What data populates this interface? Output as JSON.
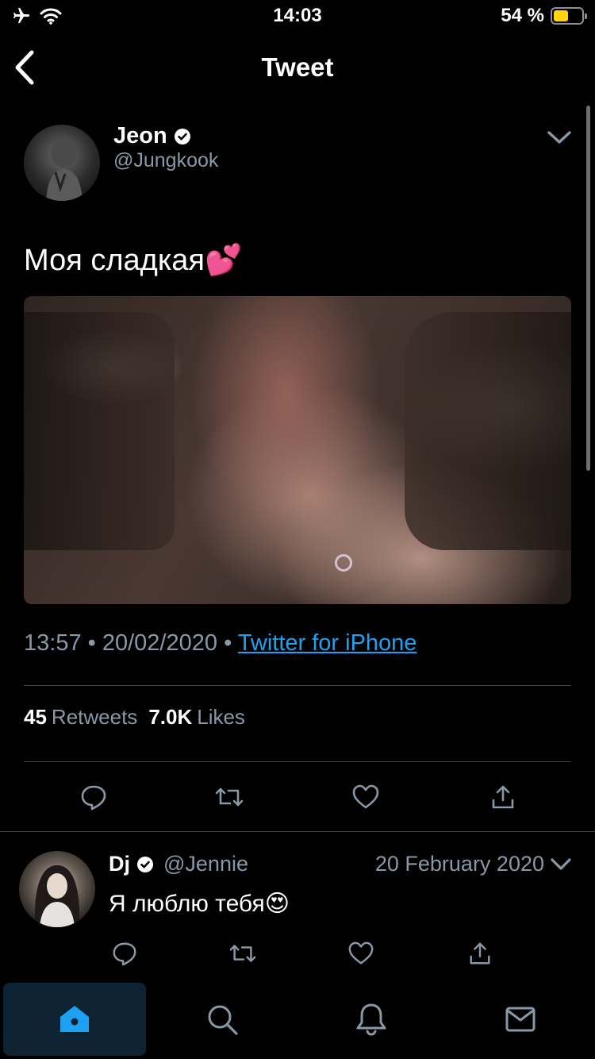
{
  "status_bar": {
    "time": "14:03",
    "battery_percent": "54 %",
    "battery_level": 0.54,
    "battery_color": "#ffd60a",
    "icons": [
      "airplane-icon",
      "wifi-icon",
      "battery-icon"
    ]
  },
  "header": {
    "title": "Tweet",
    "back_icon": "chevron-left-icon"
  },
  "tweet": {
    "author_name": "Jeon",
    "author_handle": "@Jungkook",
    "verified": true,
    "text": "Моя сладкая💕",
    "time": "13:57",
    "date": "20/02/2020",
    "separator": "•",
    "source": "Twitter for iPhone",
    "stats": {
      "retweets_count": "45",
      "retweets_label": "Retweets",
      "likes_count": "7.0K",
      "likes_label": "Likes"
    },
    "actions": [
      "reply-icon",
      "retweet-icon",
      "like-icon",
      "share-icon"
    ]
  },
  "reply": {
    "author_name": "Dj",
    "author_handle": "@Jennie",
    "verified": true,
    "date": "20 February 2020",
    "text": "Я люблю тебя😍",
    "actions": [
      "reply-icon",
      "retweet-icon",
      "like-icon",
      "share-icon"
    ]
  },
  "tabbar": {
    "tabs": [
      "home-icon",
      "search-icon",
      "notifications-icon",
      "messages-icon"
    ],
    "active": "home-icon"
  },
  "colors": {
    "background": "#000000",
    "accent": "#1da1f2",
    "secondary_text": "#8899a6",
    "divider": "#38444d"
  }
}
